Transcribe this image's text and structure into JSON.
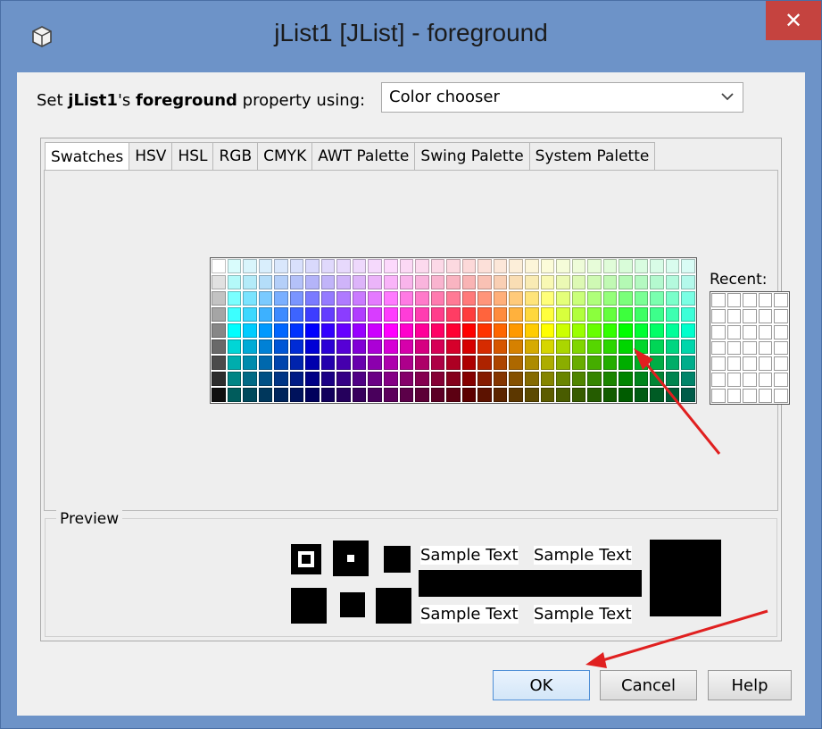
{
  "window": {
    "title": "jList1 [JList] - foreground",
    "close_glyph": "✕"
  },
  "property": {
    "prefix": "Set ",
    "component": "jList1",
    "possessive": "'s ",
    "property_name": "foreground",
    "suffix": " property using:",
    "selected": "Color chooser"
  },
  "tabs": [
    {
      "label": "Swatches",
      "active": true
    },
    {
      "label": "HSV"
    },
    {
      "label": "HSL"
    },
    {
      "label": "RGB"
    },
    {
      "label": "CMYK"
    },
    {
      "label": "AWT Palette"
    },
    {
      "label": "Swing Palette"
    },
    {
      "label": "System Palette"
    }
  ],
  "swatches": {
    "recent_label": "Recent:"
  },
  "preview": {
    "label": "Preview",
    "sample_text": "Sample Text"
  },
  "buttons": {
    "ok": "OK",
    "cancel": "Cancel",
    "help": "Help"
  },
  "colors": {
    "titlebar": "#6d93c8",
    "close": "#c5433f",
    "annotation_arrow": "#e02020"
  }
}
